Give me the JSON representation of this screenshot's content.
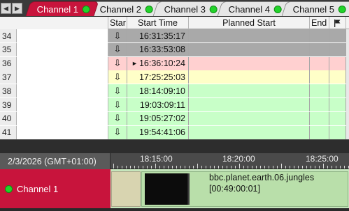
{
  "tabs": [
    {
      "label": "Channel 1",
      "active": true
    },
    {
      "label": "Channel 2",
      "active": false
    },
    {
      "label": "Channel 3",
      "active": false
    },
    {
      "label": "Channel 4",
      "active": false
    },
    {
      "label": "Channel 5",
      "active": false
    }
  ],
  "nav": {
    "left_icon": "triangle-left-icon",
    "right_icon": "triangle-right-icon"
  },
  "grid": {
    "columns": {
      "star": "Star",
      "start_time": "Start Time",
      "planned_start": "Planned Start",
      "end": "End",
      "flag": "flag-icon"
    },
    "rows": [
      {
        "num": "34",
        "arrow": "⇩",
        "start_time": "16:31:35:17",
        "state": "played",
        "current": false
      },
      {
        "num": "35",
        "arrow": "⇩",
        "start_time": "16:33:53:08",
        "state": "played",
        "current": false
      },
      {
        "num": "36",
        "arrow": "⇩",
        "start_time": "16:36:10:24",
        "state": "onair",
        "current": true
      },
      {
        "num": "37",
        "arrow": "⇩",
        "start_time": "17:25:25:03",
        "state": "next",
        "current": false
      },
      {
        "num": "38",
        "arrow": "⇩",
        "start_time": "18:14:09:10",
        "state": "ready",
        "current": false
      },
      {
        "num": "39",
        "arrow": "⇩",
        "start_time": "19:03:09:11",
        "state": "ready",
        "current": false
      },
      {
        "num": "40",
        "arrow": "⇩",
        "start_time": "19:05:27:02",
        "state": "ready",
        "current": false
      },
      {
        "num": "41",
        "arrow": "⇩",
        "start_time": "19:54:41:06",
        "state": "ready",
        "current": false
      }
    ]
  },
  "timeline": {
    "date": "2/3/2026 (GMT+01:00)",
    "ticks": [
      "18:15:00",
      "18:20:00",
      "18:25:00"
    ],
    "channel_label": "Channel 1",
    "program": {
      "name": "bbc.planet.earth.06.jungles",
      "duration": "[00:49:00:01]"
    }
  },
  "colors": {
    "accent": "#c8143c",
    "status_dot": "#22d32a",
    "played": "#a9a9a9",
    "onair": "#ffd0d0",
    "next": "#ffffc8",
    "ready": "#c8ffc8"
  }
}
